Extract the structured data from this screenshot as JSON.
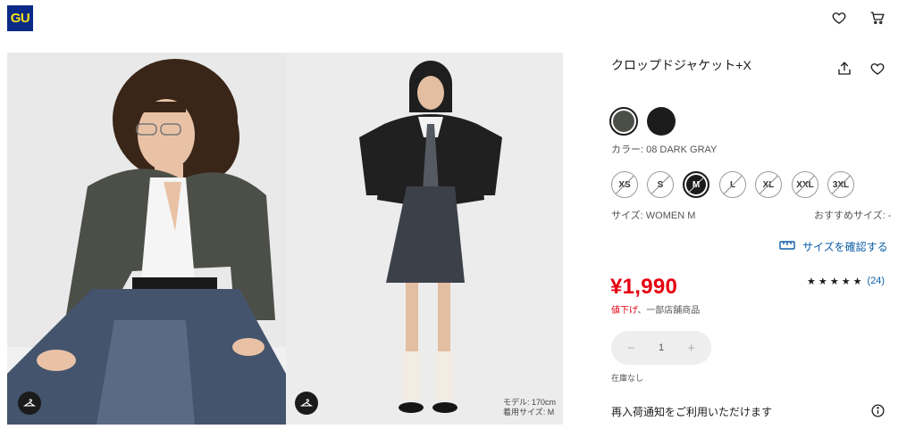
{
  "header": {
    "logo_text": "GU",
    "icons": [
      "heart-icon",
      "cart-icon"
    ]
  },
  "gallery": {
    "photos": [
      {
        "name": "model-photo-front",
        "overlay_text": ""
      },
      {
        "name": "model-photo-full",
        "overlay_text": ""
      }
    ],
    "model_info": {
      "height": "モデル: 170cm",
      "size_worn": "着用サイズ: M"
    }
  },
  "product": {
    "title": "クロップドジャケット+X",
    "colors": [
      {
        "code": "08",
        "hex": "#4c4f48",
        "selected": true
      },
      {
        "code": "09",
        "hex": "#1c1c1c",
        "selected": false
      }
    ],
    "color_label": "カラー: 08 DARK GRAY",
    "sizes": [
      {
        "label": "XS",
        "state": "disabled"
      },
      {
        "label": "S",
        "state": "disabled"
      },
      {
        "label": "M",
        "state": "selected"
      },
      {
        "label": "L",
        "state": "disabled"
      },
      {
        "label": "XL",
        "state": "disabled"
      },
      {
        "label": "XXL",
        "state": "disabled"
      },
      {
        "label": "3XL",
        "state": "disabled"
      }
    ],
    "size_label": "サイズ: WOMEN M",
    "recommended_size": "おすすめサイズ: -",
    "size_check_link": "サイズを確認する",
    "price": "¥1,990",
    "price_note_down": "値下げ",
    "price_note_rest": "、一部店舗商品",
    "rating_stars": "★ ★ ★ ★ ★",
    "rating_count": "(24)",
    "quantity": {
      "minus": "−",
      "value": "1",
      "plus": "+"
    },
    "stock_status": "在庫なし",
    "restock_notice": "再入荷通知をご利用いただけます"
  },
  "colors": {
    "price_red": "#e60012",
    "link_blue": "#0b5ea8",
    "logo_bg": "#0a2a86",
    "logo_fg": "#f7e017"
  }
}
